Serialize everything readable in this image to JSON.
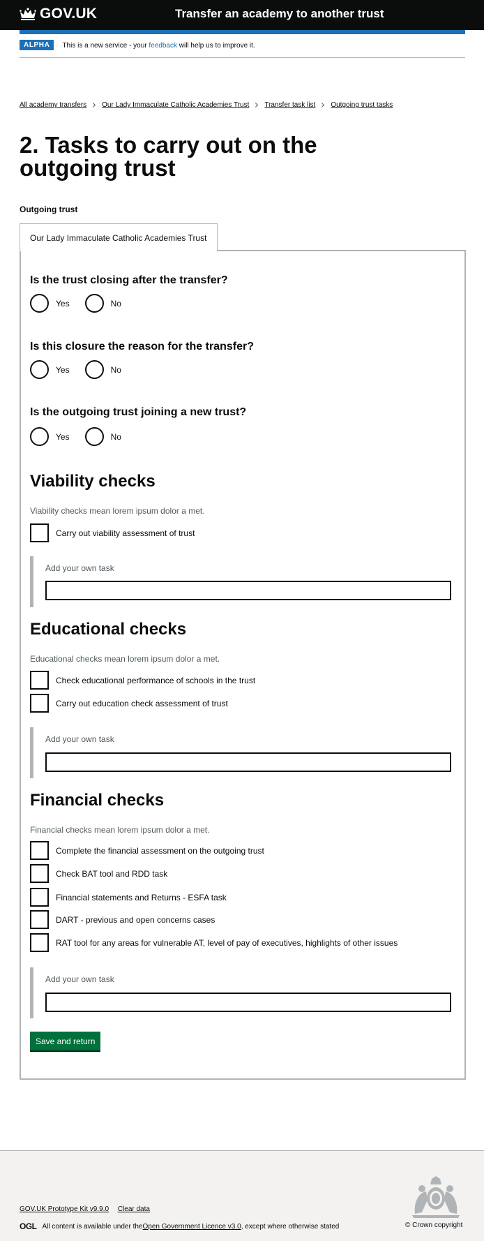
{
  "header": {
    "logo_text": "GOV.UK",
    "service_name": "Transfer an academy to another trust"
  },
  "phase_banner": {
    "tag": "ALPHA",
    "text_before": "This is a new service - your ",
    "link": "feedback",
    "text_after": " will help us to improve it."
  },
  "breadcrumbs": [
    "All academy transfers",
    "Our Lady Immaculate Catholic Academies Trust",
    "Transfer task list",
    "Outgoing trust tasks"
  ],
  "page_title": "2. Tasks to carry out on the outgoing trust",
  "fieldset_label": "Outgoing trust",
  "tab_label": "Our Lady Immaculate Catholic Academies Trust",
  "questions": [
    {
      "label": "Is the trust closing after the transfer?",
      "yes": "Yes",
      "no": "No"
    },
    {
      "label": "Is this closure the reason for the transfer?",
      "yes": "Yes",
      "no": "No"
    },
    {
      "label": "Is the outgoing trust joining a new trust?",
      "yes": "Yes",
      "no": "No"
    }
  ],
  "sections": {
    "viability": {
      "heading": "Viability checks",
      "hint": "Viability checks mean lorem ipsum dolor a met.",
      "items": [
        "Carry out viability assessment of trust"
      ],
      "add_label": "Add your own task",
      "add_value": ""
    },
    "educational": {
      "heading": "Educational checks",
      "hint": "Educational checks mean lorem ipsum dolor a met.",
      "items": [
        "Check educational performance of schools in the trust",
        "Carry out education check assessment of trust"
      ],
      "add_label": "Add your own task",
      "add_value": ""
    },
    "financial": {
      "heading": "Financial checks",
      "hint": "Financial checks mean lorem ipsum dolor a met.",
      "items": [
        "Complete the financial assessment on the outgoing trust",
        "Check BAT tool and RDD task",
        "Financial statements and Returns - ESFA task",
        "DART - previous and open concerns cases",
        "RAT tool for any areas for vulnerable AT, level of pay of executives, highlights of other issues"
      ],
      "add_label": "Add your own task",
      "add_value": ""
    }
  },
  "save_button": "Save and return",
  "footer": {
    "links": [
      "GOV.UK Prototype Kit v9.9.0",
      "Clear data"
    ],
    "ogl_logo": "OGL",
    "licence_before": "All content is available under the ",
    "licence_link": "Open Government Licence v3.0",
    "licence_after": ", except where otherwise stated",
    "copyright": "© Crown copyright"
  },
  "colors": {
    "header_bg": "#0b0c0c",
    "brand_blue": "#1d70b8",
    "button_green": "#00703c",
    "border_grey": "#b1b4b6",
    "hint_grey": "#505a5f",
    "footer_bg": "#f3f2f1"
  }
}
